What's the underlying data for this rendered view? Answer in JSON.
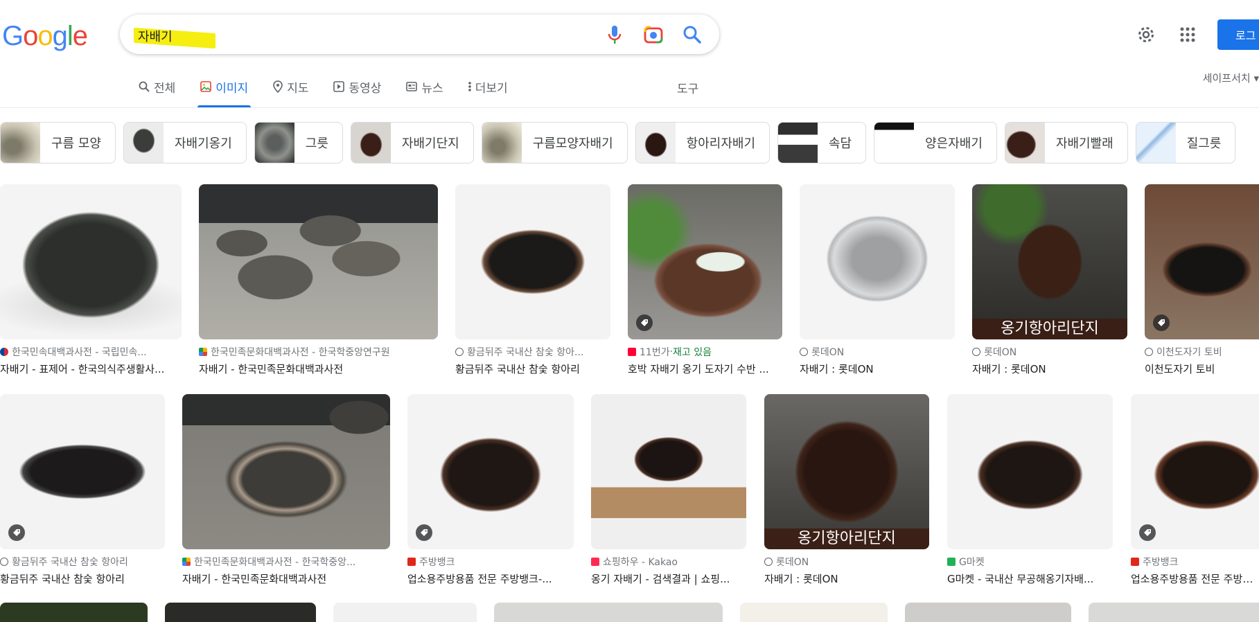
{
  "header": {
    "logo": "Google",
    "search_value": "자배기",
    "login_label": "로그"
  },
  "tabs": [
    {
      "label": "전체",
      "icon": "search-icon"
    },
    {
      "label": "이미지",
      "icon": "image-icon",
      "active": true
    },
    {
      "label": "지도",
      "icon": "map-pin-icon"
    },
    {
      "label": "동영상",
      "icon": "play-icon"
    },
    {
      "label": "뉴스",
      "icon": "news-icon"
    },
    {
      "label": "더보기",
      "icon": "more-vert-icon"
    }
  ],
  "tools_label": "도구",
  "safesearch_label": "세이프서치 ▾",
  "chips": [
    {
      "label": "구름 모양"
    },
    {
      "label": "자배기옹기"
    },
    {
      "label": "그릇"
    },
    {
      "label": "자배기단지"
    },
    {
      "label": "구름모양자배기"
    },
    {
      "label": "항아리자배기"
    },
    {
      "label": "속담"
    },
    {
      "label": "양은자배기"
    },
    {
      "label": "자배기빨래"
    },
    {
      "label": "질그릇"
    }
  ],
  "results_row1": [
    {
      "source": "한국민속대백과사전 - 국립민속...",
      "title": "자배기 - 표제어 - 한국의식주생활사..."
    },
    {
      "source": "한국민족문화대백과사전 - 한국학중앙연구원",
      "title": "자배기 - 한국민족문화대백과사전"
    },
    {
      "source": "황금뒤주 국내산 참숯 항아...",
      "title": "황금뒤주 국내산 참숯 항아리"
    },
    {
      "source": "11번가",
      "source_extra": " · ",
      "stock": "재고 있음",
      "title": "호박 자배기 옹기 도자기 수반 ..."
    },
    {
      "source": "롯데ON",
      "title": "자배기 : 롯데ON"
    },
    {
      "source": "롯데ON",
      "title": "자배기 : 롯데ON",
      "overlay": "옹기항아리단지"
    },
    {
      "source": "이천도자기 토비",
      "title": "이천도자기 토비"
    }
  ],
  "results_row2": [
    {
      "source": "황금뒤주 국내산 참숯 항아리",
      "title": "황금뒤주 국내산 참숯 항아리"
    },
    {
      "source": "한국민족문화대백과사전 - 한국학중앙...",
      "title": "자배기 - 한국민족문화대백과사전"
    },
    {
      "source": "주방뱅크",
      "title": "업소용주방용품 전문 주방뱅크-..."
    },
    {
      "source": "쇼핑하우 - Kakao",
      "title": "옹기 자배기 - 검색결과 | 쇼핑..."
    },
    {
      "source": "롯데ON",
      "title": "자배기 : 롯데ON",
      "overlay": "옹기항아리단지"
    },
    {
      "source": "G마켓",
      "title": "G마켓 - 국내산 무공해옹기자배..."
    },
    {
      "source": "주방뱅크",
      "title": "업소용주방용품 전문 주방뱅..."
    }
  ]
}
